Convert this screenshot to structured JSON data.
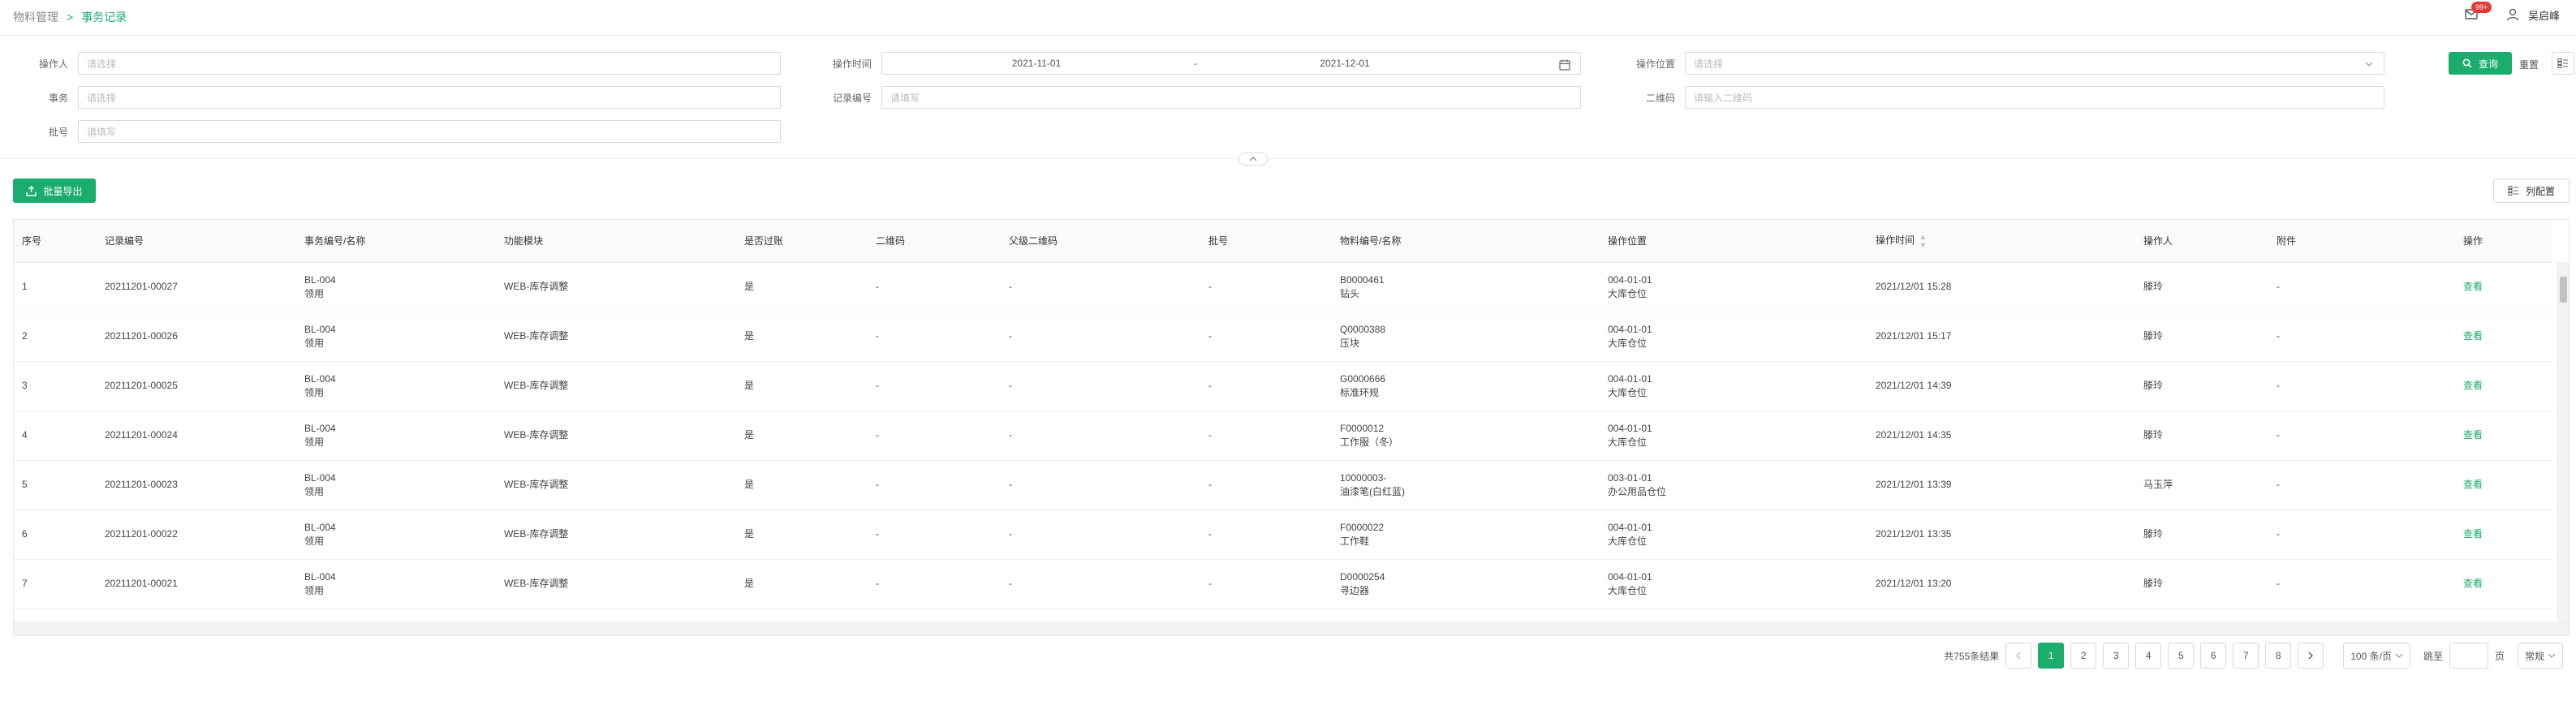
{
  "breadcrumb": {
    "parent": "物料管理",
    "separator": ">",
    "current": "事务记录"
  },
  "header": {
    "badge": "99+",
    "user_name": "吴启峰"
  },
  "filters": {
    "operator": {
      "label": "操作人",
      "placeholder": "请选择"
    },
    "op_time": {
      "label": "操作时间",
      "start": "2021-11-01",
      "dash": "-",
      "end": "2021-12-01"
    },
    "op_location": {
      "label": "操作位置",
      "placeholder": "请选择"
    },
    "transaction": {
      "label": "事务",
      "placeholder": "请选择"
    },
    "record_no": {
      "label": "记录编号",
      "placeholder": "请填写"
    },
    "qrcode": {
      "label": "二维码",
      "placeholder": "请输入二维码"
    },
    "batch": {
      "label": "批号",
      "placeholder": "请填写"
    },
    "search_label": "查询",
    "reset_label": "重置"
  },
  "toolbar": {
    "export_label": "批量导出",
    "column_config_label": "列配置"
  },
  "table": {
    "columns": [
      "序号",
      "记录编号",
      "事务编号/名称",
      "功能模块",
      "是否过账",
      "二维码",
      "父级二维码",
      "批号",
      "物料编号/名称",
      "操作位置",
      "操作时间",
      "操作人",
      "附件",
      "操作"
    ],
    "rows": [
      {
        "no": "1",
        "record": "20211201-00027",
        "tx_code": "BL-004",
        "tx_name": "领用",
        "module": "WEB-库存调整",
        "posted": "是",
        "qr": "-",
        "parent_qr": "-",
        "batch": "-",
        "mat_code": "B0000461",
        "mat_name": "钻头",
        "loc_code": "004-01-01",
        "loc_name": "大库仓位",
        "time": "2021/12/01 15:28",
        "operator": "滕玲",
        "attach": "-",
        "action": "查看"
      },
      {
        "no": "2",
        "record": "20211201-00026",
        "tx_code": "BL-004",
        "tx_name": "领用",
        "module": "WEB-库存调整",
        "posted": "是",
        "qr": "-",
        "parent_qr": "-",
        "batch": "-",
        "mat_code": "Q0000388",
        "mat_name": "压块",
        "loc_code": "004-01-01",
        "loc_name": "大库仓位",
        "time": "2021/12/01 15:17",
        "operator": "滕玲",
        "attach": "-",
        "action": "查看"
      },
      {
        "no": "3",
        "record": "20211201-00025",
        "tx_code": "BL-004",
        "tx_name": "领用",
        "module": "WEB-库存调整",
        "posted": "是",
        "qr": "-",
        "parent_qr": "-",
        "batch": "-",
        "mat_code": "G0000666",
        "mat_name": "标准环规",
        "loc_code": "004-01-01",
        "loc_name": "大库仓位",
        "time": "2021/12/01 14:39",
        "operator": "滕玲",
        "attach": "-",
        "action": "查看"
      },
      {
        "no": "4",
        "record": "20211201-00024",
        "tx_code": "BL-004",
        "tx_name": "领用",
        "module": "WEB-库存调整",
        "posted": "是",
        "qr": "-",
        "parent_qr": "-",
        "batch": "-",
        "mat_code": "F0000012",
        "mat_name": "工作服（冬）",
        "loc_code": "004-01-01",
        "loc_name": "大库仓位",
        "time": "2021/12/01 14:35",
        "operator": "滕玲",
        "attach": "-",
        "action": "查看"
      },
      {
        "no": "5",
        "record": "20211201-00023",
        "tx_code": "BL-004",
        "tx_name": "领用",
        "module": "WEB-库存调整",
        "posted": "是",
        "qr": "-",
        "parent_qr": "-",
        "batch": "-",
        "mat_code": "10000003-",
        "mat_name": "油漆笔(白红蓝)",
        "loc_code": "003-01-01",
        "loc_name": "办公用品仓位",
        "time": "2021/12/01 13:39",
        "operator": "马玉萍",
        "attach": "-",
        "action": "查看"
      },
      {
        "no": "6",
        "record": "20211201-00022",
        "tx_code": "BL-004",
        "tx_name": "领用",
        "module": "WEB-库存调整",
        "posted": "是",
        "qr": "-",
        "parent_qr": "-",
        "batch": "-",
        "mat_code": "F0000022",
        "mat_name": "工作鞋",
        "loc_code": "004-01-01",
        "loc_name": "大库仓位",
        "time": "2021/12/01 13:35",
        "operator": "滕玲",
        "attach": "-",
        "action": "查看"
      },
      {
        "no": "7",
        "record": "20211201-00021",
        "tx_code": "BL-004",
        "tx_name": "领用",
        "module": "WEB-库存调整",
        "posted": "是",
        "qr": "-",
        "parent_qr": "-",
        "batch": "-",
        "mat_code": "D0000254",
        "mat_name": "寻边器",
        "loc_code": "004-01-01",
        "loc_name": "大库仓位",
        "time": "2021/12/01 13:20",
        "operator": "滕玲",
        "attach": "-",
        "action": "查看"
      }
    ]
  },
  "pagination": {
    "total_text": "共755条结果",
    "pages": [
      "1",
      "2",
      "3",
      "4",
      "5",
      "6",
      "7",
      "8"
    ],
    "current_page": "1",
    "page_size": "100 条/页",
    "goto_label": "跳至",
    "page_unit": "页",
    "mode_select": "常规"
  },
  "colors": {
    "accent": "#1aad6d",
    "badge": "#e23a3a"
  },
  "icons": [
    "bell-icon",
    "user-icon",
    "calendar-icon",
    "chevron-down-icon",
    "search-icon",
    "column-config-icon",
    "export-icon",
    "chevron-up-icon",
    "sort-icon",
    "chevron-left-icon",
    "chevron-right-icon"
  ]
}
